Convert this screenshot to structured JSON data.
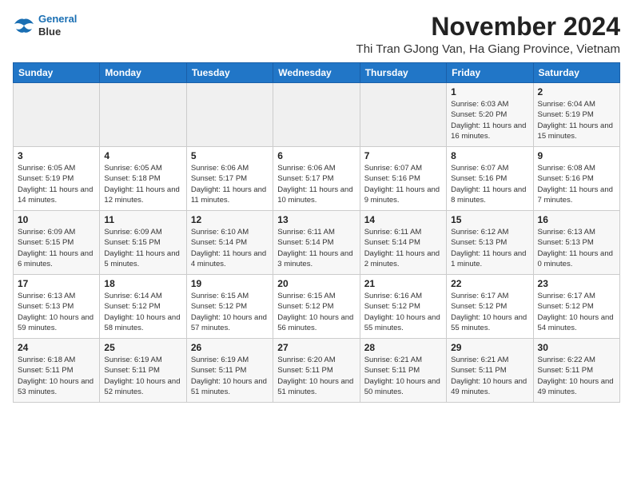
{
  "logo": {
    "line1": "General",
    "line2": "Blue"
  },
  "title": "November 2024",
  "subtitle": "Thi Tran GJong Van, Ha Giang Province, Vietnam",
  "weekdays": [
    "Sunday",
    "Monday",
    "Tuesday",
    "Wednesday",
    "Thursday",
    "Friday",
    "Saturday"
  ],
  "weeks": [
    [
      {
        "day": "",
        "info": ""
      },
      {
        "day": "",
        "info": ""
      },
      {
        "day": "",
        "info": ""
      },
      {
        "day": "",
        "info": ""
      },
      {
        "day": "",
        "info": ""
      },
      {
        "day": "1",
        "info": "Sunrise: 6:03 AM\nSunset: 5:20 PM\nDaylight: 11 hours and 16 minutes."
      },
      {
        "day": "2",
        "info": "Sunrise: 6:04 AM\nSunset: 5:19 PM\nDaylight: 11 hours and 15 minutes."
      }
    ],
    [
      {
        "day": "3",
        "info": "Sunrise: 6:05 AM\nSunset: 5:19 PM\nDaylight: 11 hours and 14 minutes."
      },
      {
        "day": "4",
        "info": "Sunrise: 6:05 AM\nSunset: 5:18 PM\nDaylight: 11 hours and 12 minutes."
      },
      {
        "day": "5",
        "info": "Sunrise: 6:06 AM\nSunset: 5:17 PM\nDaylight: 11 hours and 11 minutes."
      },
      {
        "day": "6",
        "info": "Sunrise: 6:06 AM\nSunset: 5:17 PM\nDaylight: 11 hours and 10 minutes."
      },
      {
        "day": "7",
        "info": "Sunrise: 6:07 AM\nSunset: 5:16 PM\nDaylight: 11 hours and 9 minutes."
      },
      {
        "day": "8",
        "info": "Sunrise: 6:07 AM\nSunset: 5:16 PM\nDaylight: 11 hours and 8 minutes."
      },
      {
        "day": "9",
        "info": "Sunrise: 6:08 AM\nSunset: 5:16 PM\nDaylight: 11 hours and 7 minutes."
      }
    ],
    [
      {
        "day": "10",
        "info": "Sunrise: 6:09 AM\nSunset: 5:15 PM\nDaylight: 11 hours and 6 minutes."
      },
      {
        "day": "11",
        "info": "Sunrise: 6:09 AM\nSunset: 5:15 PM\nDaylight: 11 hours and 5 minutes."
      },
      {
        "day": "12",
        "info": "Sunrise: 6:10 AM\nSunset: 5:14 PM\nDaylight: 11 hours and 4 minutes."
      },
      {
        "day": "13",
        "info": "Sunrise: 6:11 AM\nSunset: 5:14 PM\nDaylight: 11 hours and 3 minutes."
      },
      {
        "day": "14",
        "info": "Sunrise: 6:11 AM\nSunset: 5:14 PM\nDaylight: 11 hours and 2 minutes."
      },
      {
        "day": "15",
        "info": "Sunrise: 6:12 AM\nSunset: 5:13 PM\nDaylight: 11 hours and 1 minute."
      },
      {
        "day": "16",
        "info": "Sunrise: 6:13 AM\nSunset: 5:13 PM\nDaylight: 11 hours and 0 minutes."
      }
    ],
    [
      {
        "day": "17",
        "info": "Sunrise: 6:13 AM\nSunset: 5:13 PM\nDaylight: 10 hours and 59 minutes."
      },
      {
        "day": "18",
        "info": "Sunrise: 6:14 AM\nSunset: 5:12 PM\nDaylight: 10 hours and 58 minutes."
      },
      {
        "day": "19",
        "info": "Sunrise: 6:15 AM\nSunset: 5:12 PM\nDaylight: 10 hours and 57 minutes."
      },
      {
        "day": "20",
        "info": "Sunrise: 6:15 AM\nSunset: 5:12 PM\nDaylight: 10 hours and 56 minutes."
      },
      {
        "day": "21",
        "info": "Sunrise: 6:16 AM\nSunset: 5:12 PM\nDaylight: 10 hours and 55 minutes."
      },
      {
        "day": "22",
        "info": "Sunrise: 6:17 AM\nSunset: 5:12 PM\nDaylight: 10 hours and 55 minutes."
      },
      {
        "day": "23",
        "info": "Sunrise: 6:17 AM\nSunset: 5:12 PM\nDaylight: 10 hours and 54 minutes."
      }
    ],
    [
      {
        "day": "24",
        "info": "Sunrise: 6:18 AM\nSunset: 5:11 PM\nDaylight: 10 hours and 53 minutes."
      },
      {
        "day": "25",
        "info": "Sunrise: 6:19 AM\nSunset: 5:11 PM\nDaylight: 10 hours and 52 minutes."
      },
      {
        "day": "26",
        "info": "Sunrise: 6:19 AM\nSunset: 5:11 PM\nDaylight: 10 hours and 51 minutes."
      },
      {
        "day": "27",
        "info": "Sunrise: 6:20 AM\nSunset: 5:11 PM\nDaylight: 10 hours and 51 minutes."
      },
      {
        "day": "28",
        "info": "Sunrise: 6:21 AM\nSunset: 5:11 PM\nDaylight: 10 hours and 50 minutes."
      },
      {
        "day": "29",
        "info": "Sunrise: 6:21 AM\nSunset: 5:11 PM\nDaylight: 10 hours and 49 minutes."
      },
      {
        "day": "30",
        "info": "Sunrise: 6:22 AM\nSunset: 5:11 PM\nDaylight: 10 hours and 49 minutes."
      }
    ]
  ]
}
